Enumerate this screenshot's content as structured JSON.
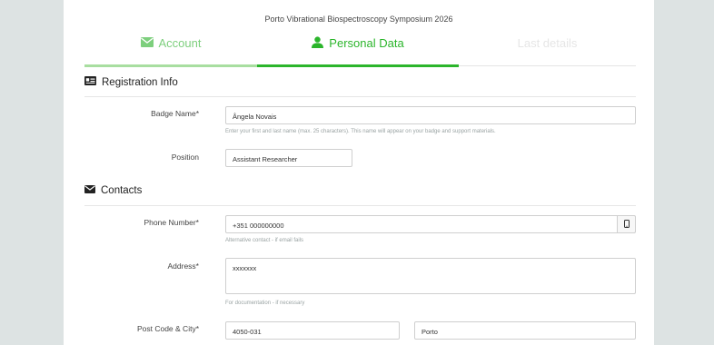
{
  "event_title": "Porto Vibrational Biospectroscopy Symposium 2026",
  "steps": [
    {
      "label": "Account",
      "icon": "envelope-icon",
      "state": "done"
    },
    {
      "label": "Personal Data",
      "icon": "user-icon",
      "state": "active"
    },
    {
      "label": "Last details",
      "icon": "",
      "state": "pending"
    }
  ],
  "sections": {
    "registration": {
      "title": "Registration Info",
      "icon": "id-card-icon"
    },
    "contacts": {
      "title": "Contacts",
      "icon": "envelope-icon"
    }
  },
  "fields": {
    "badge_name": {
      "label": "Badge Name*",
      "value": "Ângela Novais",
      "help": "Enter your first and last name (max. 25 characters). This name will appear on your badge and support materials."
    },
    "position": {
      "label": "Position",
      "value": "Assistant Researcher"
    },
    "phone": {
      "label": "Phone Number*",
      "value": "+351 000000000",
      "help": "Alternative contact - if email fails",
      "addon_icon": "mobile-phone-icon"
    },
    "address": {
      "label": "Address*",
      "value": "xxxxxxx",
      "help": "For documentation - if necessary"
    },
    "post_code_city": {
      "label": "Post Code & City*",
      "post_code": "4050-031",
      "city": "Porto"
    }
  },
  "colors": {
    "accent": "#2bb52b",
    "accent_light": "#7dcf7d",
    "background": "#dde3e3"
  }
}
